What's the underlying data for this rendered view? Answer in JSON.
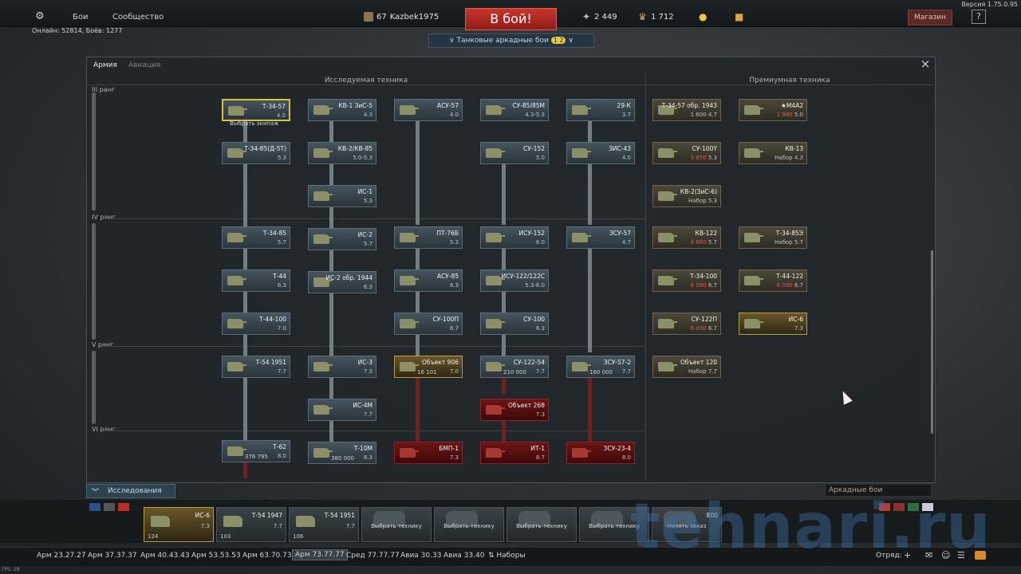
{
  "top": {
    "version": "Версия 1.75.0.95",
    "menu": [
      "Бои",
      "Сообщество"
    ],
    "online": "Онлайн: 52814, Боёв: 1277",
    "player_level": "67",
    "player_name": "Kazbek1975",
    "battle_button": "В бой!",
    "silver_lions": "2 449",
    "golden_eagles": "1 712",
    "shop": "Магазин",
    "help": "?",
    "mode": "Танковые аркадные бои",
    "mode_badge": "1 2"
  },
  "window": {
    "tabs": [
      "Армия",
      "Авиация"
    ],
    "close": "×",
    "header_research": "Исследуемая техника",
    "header_premium": "Премиумная техника",
    "ranks": [
      "III ранг",
      "IV ранг",
      "V ранг",
      "VI ранг"
    ]
  },
  "cards": [
    {
      "name": "Т-34-57",
      "br": "4.0",
      "hint": "Выбрать экипаж"
    },
    {
      "name": "Т-34-85(Д-5Т)",
      "br": "5.3"
    },
    {
      "name": "Т-34-85",
      "br": "5.7"
    },
    {
      "name": "Т-44",
      "br": "6.3"
    },
    {
      "name": "Т-44-100",
      "br": "7.0"
    },
    {
      "name": "Т-54 1951",
      "br": "7.7"
    },
    {
      "name": "Т-62",
      "br": "8.0",
      "cost": "376 795"
    },
    {
      "name": "КВ-1 ЗиС-5",
      "br": "4.3"
    },
    {
      "name": "КВ-2/КВ-85",
      "br": "5.0-5.3"
    },
    {
      "name": "ИС-1",
      "br": "5.3"
    },
    {
      "name": "ИС-2",
      "br": "5.7"
    },
    {
      "name": "ИС-2 обр. 1944",
      "br": "6.3"
    },
    {
      "name": "ИС-3",
      "br": "7.3"
    },
    {
      "name": "ИС-4М",
      "br": "7.7"
    },
    {
      "name": "Т-10М",
      "br": "8.3",
      "cost": "380 000"
    },
    {
      "name": "АСУ-57",
      "br": "4.0"
    },
    {
      "name": "ПТ-76Б",
      "br": "5.3"
    },
    {
      "name": "АСУ-85",
      "br": "6.3"
    },
    {
      "name": "СУ-100П",
      "br": "6.7"
    },
    {
      "name": "Объект 906",
      "br": "7.0",
      "cost": "16 101"
    },
    {
      "name": "БМП-1",
      "br": "7.3"
    },
    {
      "name": "СУ-85/85М",
      "br": "4.3-5.3"
    },
    {
      "name": "СУ-152",
      "br": "5.0"
    },
    {
      "name": "ИСУ-152",
      "br": "6.0"
    },
    {
      "name": "ИСУ-122/122С",
      "br": "5.3-6.0"
    },
    {
      "name": "СУ-100",
      "br": "6.3"
    },
    {
      "name": "СУ-122-54",
      "br": "7.7",
      "cost": "210 000"
    },
    {
      "name": "Объект 268",
      "br": "7.3"
    },
    {
      "name": "ИТ-1",
      "br": "8.7"
    },
    {
      "name": "29-К",
      "br": "3.7"
    },
    {
      "name": "ЗИС-43",
      "br": "4.0"
    },
    {
      "name": "ЗСУ-57",
      "br": "4.7"
    },
    {
      "name": "ЗСУ-57-2",
      "br": "7.7",
      "cost": "160 000"
    },
    {
      "name": "ЗСУ-23-4",
      "br": "8.0"
    },
    {
      "name": "Т-34-57 обр. 1943",
      "br": "4.7",
      "cost": "1 600"
    },
    {
      "name": "СУ-100Y",
      "br": "5.3",
      "cost": "3 850"
    },
    {
      "name": "КВ-2(ЗиС-6)",
      "br": "5.3",
      "cost": "Набор"
    },
    {
      "name": "КВ-122",
      "br": "5.7",
      "cost": "4 880"
    },
    {
      "name": "Т-34-100",
      "br": "6.7",
      "cost": "6 090"
    },
    {
      "name": "СУ-122П",
      "br": "6.7",
      "cost": "6 090"
    },
    {
      "name": "Объект 120",
      "br": "7.7",
      "cost": "Набор"
    },
    {
      "name": "★M4A2",
      "br": "5.0",
      "cost": "2 980"
    },
    {
      "name": "КВ-13",
      "br": "4.3",
      "cost": "Набор"
    },
    {
      "name": "Т-34-85Э",
      "br": "5.7",
      "cost": "Набор"
    },
    {
      "name": "Т-44-122",
      "br": "6.7",
      "cost": "6 090"
    },
    {
      "name": "ИС-6",
      "br": "7.3"
    }
  ],
  "bottom": {
    "research": "Исследования",
    "arcade": "Аркадные бои",
    "slots": [
      {
        "name": "ИС-6",
        "br": "7.3",
        "num": "124"
      },
      {
        "name": "Т-54 1947",
        "br": "7.7",
        "num": "103"
      },
      {
        "name": "Т-54 1951",
        "br": "7.7",
        "num": "106"
      },
      {
        "hint": "Выбрать технику"
      },
      {
        "hint": "Выбрать технику"
      },
      {
        "hint": "Выбрать технику"
      },
      {
        "hint": "Выбрать технику"
      },
      {
        "hint": "Начать заказ",
        "cost": "800"
      }
    ],
    "br_items": [
      "Арм 23.27.27",
      "Арм 37.37.37",
      "Арм 40.43.43",
      "Арм 53.53.53",
      "Арм 63.70.73",
      "Арм 73.77.77",
      "Сред 77.77.77",
      "Авиа 30.33",
      "Авиа 33.40",
      "⇅ Наборы"
    ],
    "squad": "Отряд:",
    "fps": "FPS: 28",
    "watermark": "tehnari.ru"
  }
}
